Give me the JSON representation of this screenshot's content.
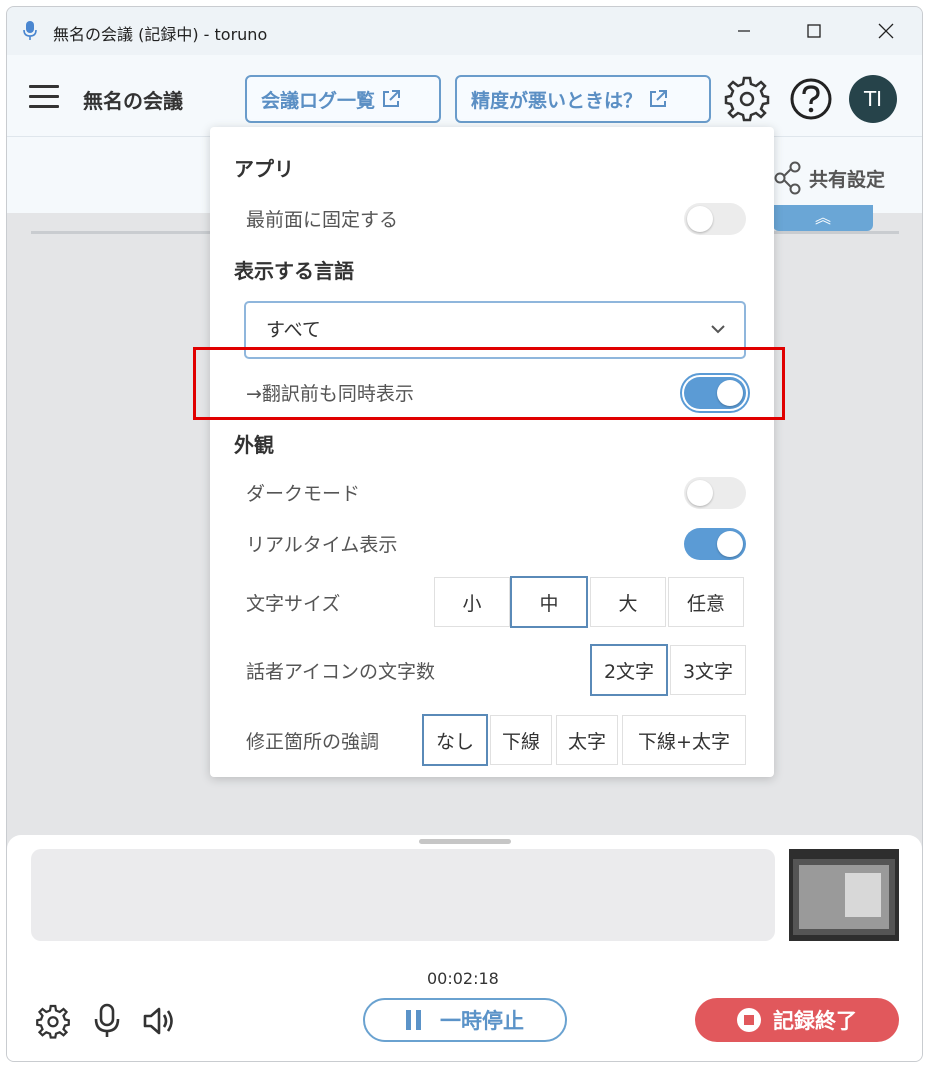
{
  "window": {
    "title": "無名の会議 (記録中) - toruno"
  },
  "header": {
    "meeting_title": "無名の会議",
    "log_list_label": "会議ログ一覧",
    "accuracy_help_label": "精度が悪いときは？",
    "avatar_initials": "TI"
  },
  "subheader": {
    "share_label": "共有設定",
    "collapse_symbol": "︽"
  },
  "settings": {
    "app_section": "アプリ",
    "always_on_top_label": "最前面に固定する",
    "always_on_top": false,
    "language_section": "表示する言語",
    "language_value": "すべて",
    "show_original_label": "→翻訳前も同時表示",
    "show_original": true,
    "appearance_section": "外観",
    "dark_mode_label": "ダークモード",
    "dark_mode": false,
    "realtime_label": "リアルタイム表示",
    "realtime": true,
    "font_size_label": "文字サイズ",
    "font_size_options": [
      "小",
      "中",
      "大",
      "任意"
    ],
    "font_size_selected": "中",
    "speaker_chars_label": "話者アイコンの文字数",
    "speaker_chars_options": [
      "2文字",
      "3文字"
    ],
    "speaker_chars_selected": "2文字",
    "emphasis_label": "修正箇所の強調",
    "emphasis_options": [
      "なし",
      "下線",
      "太字",
      "下線+太字"
    ],
    "emphasis_selected": "なし"
  },
  "bottom": {
    "timer": "00:02:18",
    "pause_label": "一時停止",
    "stop_label": "記録終了"
  },
  "colors": {
    "accent": "#5b9bd5",
    "stop": "#e1585c",
    "highlight": "#e00000",
    "avatar": "#26434a"
  }
}
